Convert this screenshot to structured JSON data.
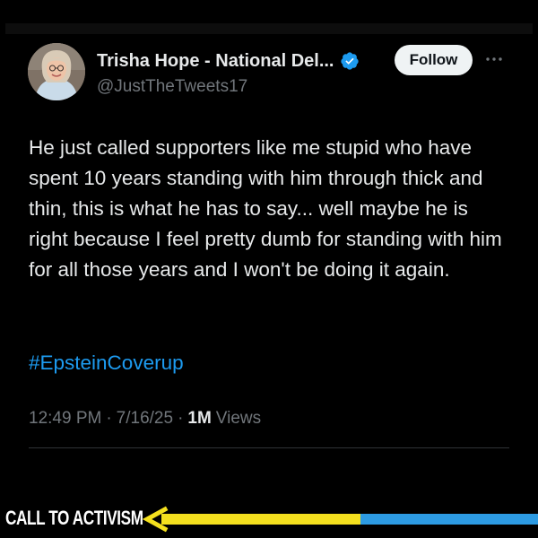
{
  "tweet": {
    "author": {
      "display_name": "Trisha Hope - National Del...",
      "handle": "@JustTheTweets17",
      "verified": true,
      "avatar_icon": "profile-photo"
    },
    "follow_label": "Follow",
    "more_icon": "more-dots-icon",
    "text": "He just called supporters like me stupid who have spent 10 years standing with him through thick and thin, this is what he has to say... well maybe he is right because I feel pretty dumb for standing with him for all those years and I won't be doing it again.",
    "hashtag": "#EpsteinCoverup",
    "time": "12:49 PM",
    "separator": "·",
    "date": "7/16/25",
    "views_count": "1M",
    "views_label": "Views"
  },
  "banner": {
    "text": "CALL TO ACTIVISM",
    "arrow_icon": "left-arrow-icon"
  },
  "colors": {
    "background": "#000000",
    "text_primary": "#e7e9ea",
    "text_secondary": "#71767b",
    "link": "#1d9bf0",
    "verified_badge": "#1d9bf0",
    "follow_button_bg": "#eff3f4",
    "arrow_yellow": "#f4e01e",
    "arrow_blue": "#2d9be3"
  }
}
